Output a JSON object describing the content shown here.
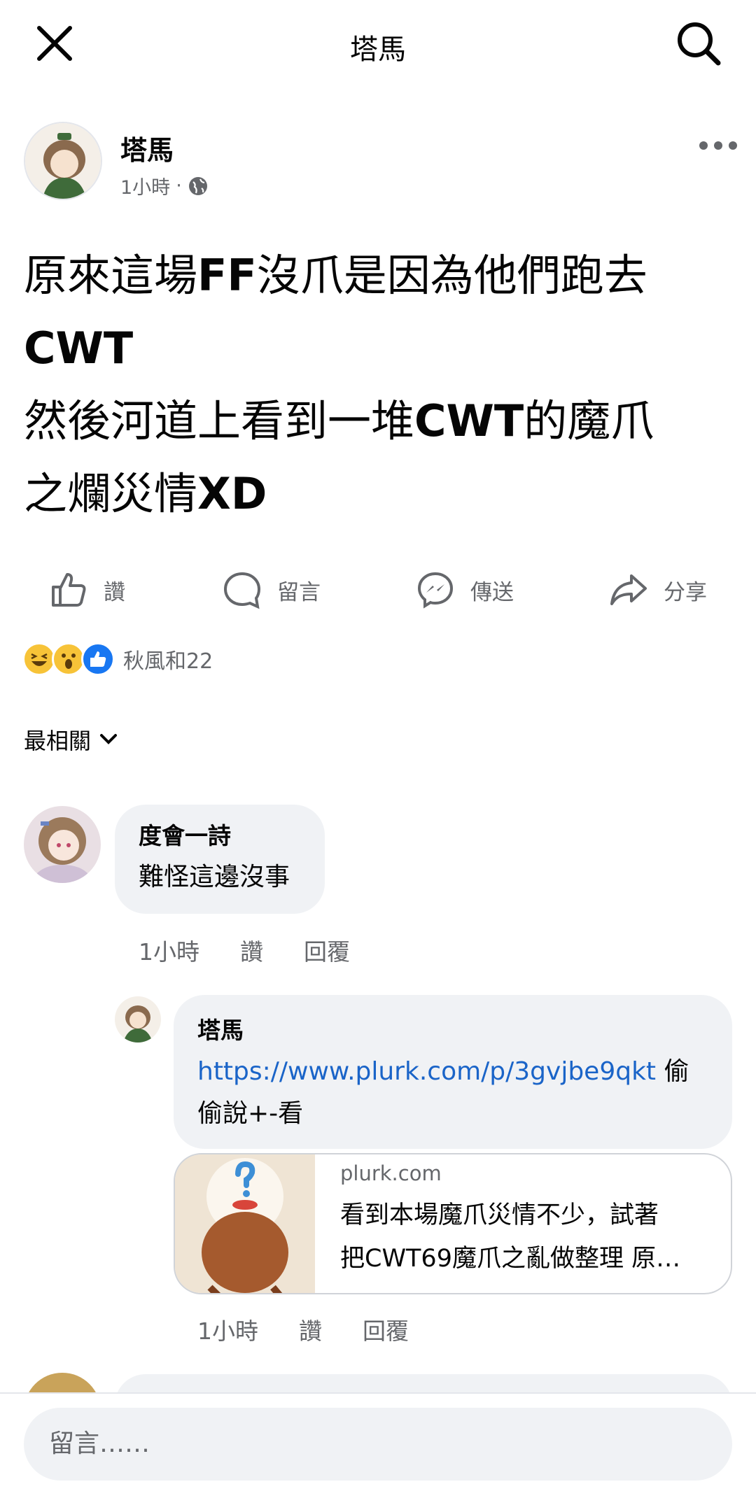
{
  "topbar": {
    "title": "塔馬"
  },
  "post": {
    "author": "塔馬",
    "time": "1小時",
    "separator": "·",
    "lines": [
      [
        {
          "t": "原來這場",
          "b": false
        },
        {
          "t": "FF",
          "b": true
        },
        {
          "t": "沒爪是因為他們跑去",
          "b": false
        }
      ],
      [
        {
          "t": "CWT",
          "b": true
        }
      ],
      [
        {
          "t": "然後河道上看到一堆",
          "b": false
        },
        {
          "t": "CWT",
          "b": true
        },
        {
          "t": "的魔爪",
          "b": false
        }
      ],
      [
        {
          "t": "之爛災情",
          "b": false
        },
        {
          "t": "XD",
          "b": true
        }
      ]
    ]
  },
  "actions": {
    "like": "讚",
    "comment": "留言",
    "send": "傳送",
    "share": "分享"
  },
  "reactions": {
    "text": "秋風和22",
    "icons": [
      "laugh-emoji",
      "wow-emoji",
      "like-emoji"
    ]
  },
  "sort": {
    "label": "最相關"
  },
  "comments": [
    {
      "author": "度會一詩",
      "text": "難怪這邊沒事",
      "time": "1小時",
      "like": "讚",
      "reply": "回覆"
    },
    {
      "author": "塔馬",
      "link": "https://www.plurk.com/p/3gvjbe9qkt",
      "text_after_link": " 偷",
      "text_line2": "偷說+-看",
      "preview": {
        "domain": "plurk.com",
        "line1": "看到本場魔爪災情不少，試著",
        "line2": "把CWT69魔爪之亂做整理 原…"
      },
      "time": "1小時",
      "like": "讚",
      "reply": "回覆"
    }
  ],
  "composer": {
    "placeholder": "留言……"
  },
  "colors": {
    "link": "#1a64c8",
    "bubble": "#f0f2f5",
    "secondary": "#65676b"
  }
}
